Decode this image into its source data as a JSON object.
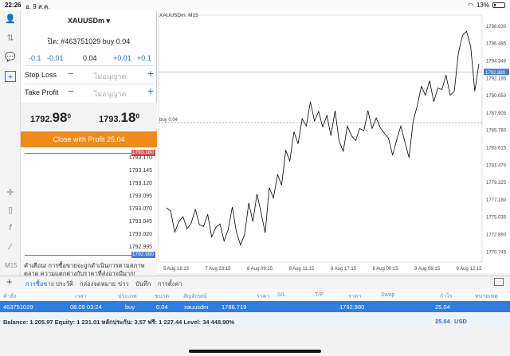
{
  "status_bar": {
    "time": "22:26",
    "date": "อ. 9 ส.ค.",
    "battery": "13%"
  },
  "order_panel": {
    "symbol": "XAUUSDm",
    "order_label": "ปิด: #463751029 buy 0.04",
    "volume_steps": [
      "-0.1",
      "-0.01",
      "0.04",
      "+0.01",
      "+0.1"
    ],
    "stop_loss": {
      "label": "Stop Loss",
      "placeholder": "ไม่อนุญาต"
    },
    "take_profit": {
      "label": "Take Profit",
      "placeholder": "ไม่อนุญาต"
    },
    "bid": {
      "main": "1792.",
      "big": "98",
      "sup": "0"
    },
    "ask": {
      "main": "1793.",
      "big": "18",
      "sup": "0"
    },
    "close_button": "Close with Profit 25.04",
    "depth_ticks": [
      "1793.170",
      "1793.145",
      "1793.120",
      "1793.095",
      "1793.070",
      "1793.045",
      "1793.020",
      "1792.995"
    ],
    "ask_badge": "1793.180",
    "bid_badge": "1792.980",
    "warning": "คำเตือน! การซื้อขายจะถูกดำเนินการตามสภาพตลาด ความแตกต่างกับราคาที่ส่งอาจมีมาก!"
  },
  "chart": {
    "title": "XAUUSDm, M15",
    "order_line_label": "buy 0.04",
    "current_price_badge": "1792.980",
    "y_ticks": [
      "1798.630",
      "1796.485",
      "1794.340",
      "1792.195",
      "1790.050",
      "1787.905",
      "1785.760",
      "1783.615",
      "1781.470",
      "1779.325",
      "1777.180",
      "1775.035",
      "1772.890",
      "1770.745"
    ],
    "x_ticks": [
      "5 Aug 16:15",
      "7 Aug 23:15",
      "8 Aug 09:15",
      "8 Aug 11:15",
      "8 Aug 17:15",
      "8 Aug 00:15",
      "9 Aug 06:15",
      "9 Aug 12:15"
    ],
    "colors": {
      "line": "#000000",
      "order_line": "#888888",
      "price_badge": "#4a7bd0"
    }
  },
  "chart_data": {
    "type": "line",
    "title": "XAUUSDm, M15",
    "series": [
      {
        "name": "XAUUSDm",
        "values": [
          1776.2,
          1775.8,
          1773.2,
          1774.5,
          1775.1,
          1773.6,
          1774.3,
          1776.0,
          1774.1,
          1773.9,
          1775.4,
          1772.6,
          1773.8,
          1774.2,
          1772.1,
          1773.5,
          1776.3,
          1773.2,
          1771.6,
          1772.9,
          1776.8,
          1774.5,
          1777.9,
          1775.6,
          1773.1,
          1778.7,
          1777.4,
          1780.3,
          1779.0,
          1783.3,
          1782.0,
          1785.6,
          1784.1,
          1787.2,
          1786.3,
          1789.3,
          1786.9,
          1788.1,
          1786.2,
          1787.6,
          1785.1,
          1788.2,
          1784.4,
          1783.2,
          1786.3,
          1785.1,
          1784.5,
          1786.0,
          1785.7,
          1788.2,
          1786.0,
          1787.3,
          1786.1,
          1785.4,
          1784.8,
          1782.7,
          1784.6,
          1786.3,
          1784.3,
          1782.4,
          1786.9,
          1788.8,
          1791.2,
          1790.1,
          1791.9,
          1789.3,
          1791.0,
          1790.8,
          1792.6,
          1790.1,
          1790.6,
          1795.3,
          1797.5,
          1798.0,
          1796.1,
          1790.6,
          1794.0
        ]
      }
    ],
    "ylim": [
      1769.5,
      1800.0
    ],
    "order_line": 1786.72,
    "current_price": 1792.98
  },
  "tabs": [
    "การซื้อขาย",
    "ประวัติ",
    "กล่องจดหมาย",
    "ข่าว",
    "บันทึก",
    "การตั้งค่า"
  ],
  "table": {
    "headers": [
      "คำสั่ง",
      "เวลา",
      "ประเภท",
      "ขนาด",
      "สัญลักษณ์",
      "ราคา",
      "S/L",
      "T/P",
      "ราคา",
      "Swap",
      "กำไร",
      "หมายเหตุ"
    ],
    "row": {
      "order": "463751029",
      "time": "08.09 03:24",
      "type": "buy",
      "volume": "0.04",
      "symbol": "xauusdm",
      "open_price": "1786.719",
      "price": "1792.980",
      "profit": "25.04"
    }
  },
  "balance": {
    "text": "Balance: 1 205.97 Equity: 1 231.01 หลักประกัน: 3.57 ฟรี: 1 227.44 Level: 34 448.90%",
    "profit": "25.04",
    "currency": "USD"
  }
}
